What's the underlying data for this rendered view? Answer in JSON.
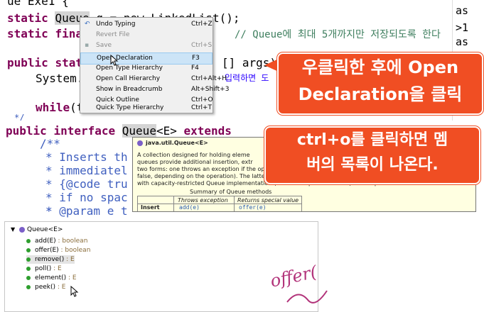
{
  "top_editor": {
    "line0": "ue Exe1 {",
    "line1_kw1": "static",
    "line1_type": "Queue",
    "line1_rest": "q = new LinkedList();",
    "line2_kw1": "static",
    "line2_kw2": "fina",
    "line2_comment": "// Queue에 최대 5개까지만 저장되도록 한다",
    "line3_kw1": "public",
    "line3_kw2": "stat",
    "line3_rest": "[] args){",
    "line4": "System.",
    "line4_korean": "입력하면 도",
    "line5_kw": "while",
    "line5_rest": "(t",
    "line6": "*/"
  },
  "right_strip": [
    "as",
    ">1",
    "as"
  ],
  "context_menu": {
    "items": [
      {
        "label": "Undo Typing",
        "shortcut": "Ctrl+Z",
        "disabled": false
      },
      {
        "label": "Revert File",
        "shortcut": "",
        "disabled": true
      },
      {
        "label": "Save",
        "shortcut": "Ctrl+S",
        "disabled": true
      },
      {
        "label": "Open Declaration",
        "shortcut": "F3",
        "disabled": false,
        "selected": true
      },
      {
        "label": "Open Type Hierarchy",
        "shortcut": "F4",
        "disabled": false
      },
      {
        "label": "Open Call Hierarchy",
        "shortcut": "Ctrl+Alt+H",
        "disabled": false
      },
      {
        "label": "Show in Breadcrumb",
        "shortcut": "Alt+Shift+3",
        "disabled": false
      },
      {
        "label": "Quick Outline",
        "shortcut": "Ctrl+O",
        "disabled": false
      },
      {
        "label": "Quick Type Hierarchy",
        "shortcut": "Ctrl+T",
        "disabled": false
      }
    ]
  },
  "callout1": {
    "line1": "우클릭한 후에 Open",
    "line2": "Declaration을 클릭"
  },
  "callout2": {
    "line1": "ctrl+o를 클릭하면 멤",
    "line2": "버의 목록이 나온다."
  },
  "mid_editor": {
    "decl_kw1": "public",
    "decl_kw2": "interface",
    "decl_type": "Queue",
    "decl_generic": "<E>",
    "decl_ext": "extends",
    "l1": "/**",
    "l2": "* Inserts th",
    "l3": "* immediatel",
    "l4": "* {@code tru",
    "l5": "* if no spac",
    "l6": "*",
    "l7": "* @param e t"
  },
  "hover": {
    "title": "java.util.Queue<E>",
    "para1": "A collection designed for holding eleme",
    "para2": "queues provide additional insertion, extr",
    "para3": "two forms: one throws an exception if the operation fails, the other returns a special value (either null or",
    "para4": "false, depending on the operation). The latter form of the insert operation is designed specifically for use",
    "para5": "with capacity-restricted Queue implementations; in most implementations, insert operations cannot fail.",
    "table_caption": "Summary of Queue methods",
    "col1": "Throws exception",
    "col2": "Returns special value",
    "row_label": "Insert",
    "cell1": "add(e)",
    "cell2": "offer(e)"
  },
  "outline": {
    "root": "Queue<E>",
    "items": [
      {
        "name": "add(E)",
        "suffix": " : boolean"
      },
      {
        "name": "offer(E)",
        "suffix": " : boolean"
      },
      {
        "name": "remove()",
        "suffix": " : E"
      },
      {
        "name": "poll()",
        "suffix": " : E"
      },
      {
        "name": "element()",
        "suffix": " : E"
      },
      {
        "name": "peek()",
        "suffix": " : E"
      }
    ]
  },
  "handwriting": "offer(",
  "colors": {
    "callout": "#f04e23",
    "keyword": "#7f0055",
    "comment": "#3f7f5f",
    "javadoc": "#3f5fbf",
    "hover_bg": "#ffffe1",
    "menu_selected": "#cce4f7"
  }
}
